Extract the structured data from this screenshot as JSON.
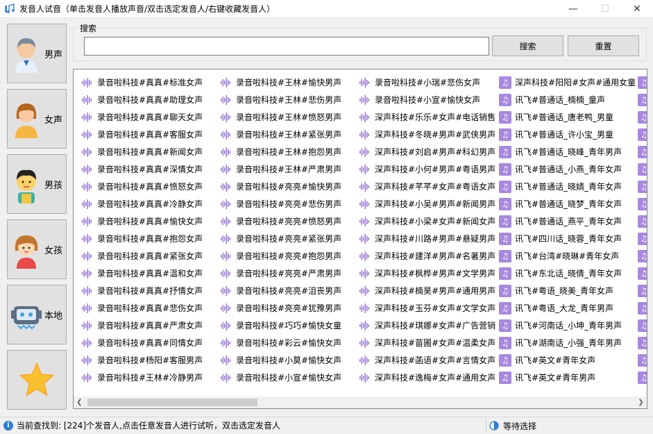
{
  "window": {
    "title": "发音人试音（单击发音人播放声音/双击选定发音人/右键收藏发音人）",
    "minimize": "—",
    "maximize": "☐",
    "close": "✕"
  },
  "categories": [
    {
      "label": "男声",
      "icon": "male-voice-icon"
    },
    {
      "label": "女声",
      "icon": "female-voice-icon"
    },
    {
      "label": "男孩",
      "icon": "boy-icon"
    },
    {
      "label": "女孩",
      "icon": "girl-icon"
    },
    {
      "label": "本地",
      "icon": "robot-icon"
    },
    {
      "label": "",
      "icon": "star-icon"
    }
  ],
  "search": {
    "legend": "搜索",
    "value": "",
    "search_button": "搜索",
    "reset_button": "重置"
  },
  "list": {
    "columns": [
      {
        "icon": "waveform-icon",
        "items": [
          "录音啦科技#真真#标准女声",
          "录音啦科技#真真#助理女声",
          "录音啦科技#真真#聊天女声",
          "录音啦科技#真真#客服女声",
          "录音啦科技#真真#新闻女声",
          "录音啦科技#真真#深情女声",
          "录音啦科技#真真#愤怒女声",
          "录音啦科技#真真#冷静女声",
          "录音啦科技#真真#愉快女声",
          "录音啦科技#真真#抱怨女声",
          "录音啦科技#真真#紧张女声",
          "录音啦科技#真真#温和女声",
          "录音啦科技#真真#抒情女声",
          "录音啦科技#真真#悲伤女声",
          "录音啦科技#真真#严肃女声",
          "录音啦科技#真真#同情女声",
          "录音啦科技#杨阳#客服男声",
          "录音啦科技#王林#冷静男声"
        ]
      },
      {
        "icon": "waveform-icon",
        "items": [
          "录音啦科技#王林#愉快男声",
          "录音啦科技#王林#悲伤男声",
          "录音啦科技#王林#愤怒男声",
          "录音啦科技#王林#紧张男声",
          "录音啦科技#王林#抱怨男声",
          "录音啦科技#王林#严肃男声",
          "录音啦科技#亮亮#愉快男声",
          "录音啦科技#亮亮#悲伤男声",
          "录音啦科技#亮亮#愤怒男声",
          "录音啦科技#亮亮#紧张男声",
          "录音啦科技#亮亮#抱怨男声",
          "录音啦科技#亮亮#严肃男声",
          "录音啦科技#亮亮#沮丧男声",
          "录音啦科技#亮亮#犹豫男声",
          "录音啦科技#巧巧#愉快女童",
          "录音啦科技#彩云#愉快女声",
          "录音啦科技#小莫#愉快女声",
          "录音啦科技#小宣#愉快女声"
        ]
      },
      {
        "icon": "waveform-icon",
        "items": [
          "录音啦科技#小瑞#悲伤女声",
          "录音啦科技#小宣#愉快女声",
          "深声科技#乐乐#女声#电话销售",
          "深声科技#冬晓#男声#武侠男声",
          "深声科技#刘启#男声#科幻男声",
          "深声科技#小何#男声#粤语男声",
          "深声科技#芊芊#女声#粤语女声",
          "深声科技#小吴#男声#新闻男声",
          "深声科技#小梁#女声#新闻女声",
          "深声科技#川路#男声#悬疑男声",
          "深声科技#建洋#男声#名著男声",
          "深声科技#枫桦#男声#文学男声",
          "深声科技#楠昊#男声#通用男声",
          "深声科技#玉芬#女声#文学女声",
          "深声科技#琪娜#女声#广告营销",
          "深声科技#苗圃#女声#温柔女声",
          "深声科技#菡语#女声#言情女声",
          "深声科技#逸梅#女声#通用女声"
        ]
      },
      {
        "icon": "music-note-icon",
        "items": [
          "深声科技#阳阳#女声#通用女童",
          "讯飞#普通话_楠楠_童声",
          "讯飞#普通话_唐老鸭_男童",
          "讯飞#普通话_许小宝_男童",
          "讯飞#普通话_晓峰_青年男声",
          "讯飞#普通话_小燕_青年女声",
          "讯飞#普通话_晓婧_青年女声",
          "讯飞#普通话_晓梦_青年女声",
          "讯飞#普通话_燕平_青年女声",
          "讯飞#四川话_晓蓉_青年女声",
          "讯飞#台湾#晓琳#青年女声",
          "讯飞#东北话_晓倩_青年女声",
          "讯飞#粤语_晓美_青年女声",
          "讯飞#粤语_大龙_青年男声",
          "讯飞#河南话_小坤_青年男声",
          "讯飞#湖南话_小强_青年男声",
          "讯飞#英文#青年女声",
          "讯飞#英文#青年男声"
        ]
      },
      {
        "icon": "music-note-icon",
        "items": [
          "",
          "",
          "",
          "",
          "",
          "",
          "",
          "",
          "",
          "",
          "",
          "",
          "",
          "",
          "",
          "",
          "",
          ""
        ]
      }
    ]
  },
  "status": {
    "left": "当前查找到: [224]个发音人,点击任意发音人进行试听，双击选定发音人",
    "right": "等待选择"
  }
}
